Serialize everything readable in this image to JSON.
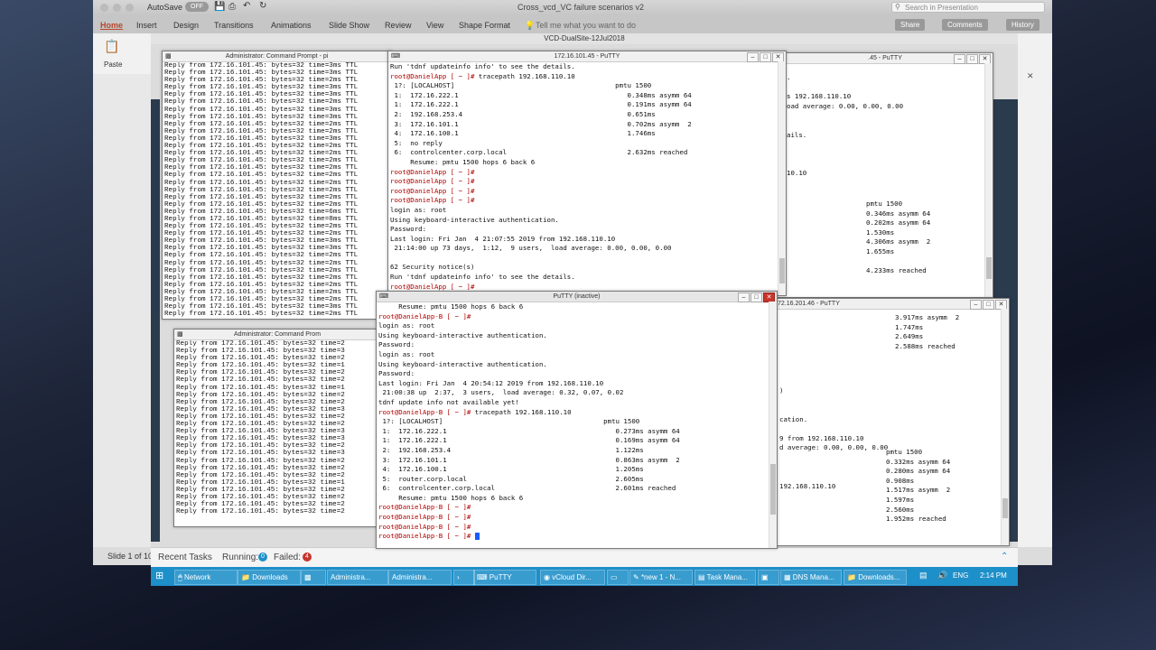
{
  "app": {
    "title": "Cross_vcd_VC failure scenarios v2",
    "autosave": "AutoSave",
    "autosave_state": "OFF",
    "search_placeholder": "Search in Presentation",
    "share": "Share",
    "comments": "Comments",
    "history": "History"
  },
  "menu": [
    "Home",
    "Insert",
    "Design",
    "Transitions",
    "Animations",
    "Slide Show",
    "Review",
    "View",
    "Shape Format"
  ],
  "tell_me": "Tell me what you want to do",
  "ribbon": {
    "paste": "Paste"
  },
  "status": {
    "slide": "Slide 1 of 10"
  },
  "rdp": {
    "title": "VCD-DualSite-12Jul2018"
  },
  "recent_tasks": {
    "label": "Recent Tasks",
    "running_label": "Running:",
    "running": "0",
    "failed_label": "Failed:",
    "failed": "4"
  },
  "taskbar": {
    "items": [
      "Network",
      "Downloads",
      "",
      "Administra...",
      "Administra...",
      "",
      "PuTTY",
      "vCloud Dir...",
      "",
      "*new 1 - N...",
      "Task Mana...",
      "",
      "DNS Mana...",
      "Downloads..."
    ],
    "lang": "ENG",
    "time": "2:14 PM"
  },
  "windows": {
    "cmd1": {
      "title": "Administrator: Command Prompt - pi"
    },
    "cmd2": {
      "title": "Administrator: Command Prom"
    },
    "putty_top": {
      "title": "172.16.101.45 - PuTTY"
    },
    "putty_right_top": {
      "title": ".45 - PuTTY"
    },
    "putty_inactive": {
      "title": "PuTTY (inactive)"
    },
    "putty_right_bottom": {
      "title": "72.16.201.46 - PuTTY"
    }
  },
  "cmd1_lines": [
    "Reply from 172.16.101.45: bytes=32 time=3ms TTL",
    "Reply from 172.16.101.45: bytes=32 time=3ms TTL",
    "Reply from 172.16.101.45: bytes=32 time=2ms TTL",
    "Reply from 172.16.101.45: bytes=32 time=3ms TTL",
    "Reply from 172.16.101.45: bytes=32 time=3ms TTL",
    "Reply from 172.16.101.45: bytes=32 time=2ms TTL",
    "Reply from 172.16.101.45: bytes=32 time=3ms TTL",
    "Reply from 172.16.101.45: bytes=32 time=3ms TTL",
    "Reply from 172.16.101.45: bytes=32 time=2ms TTL",
    "Reply from 172.16.101.45: bytes=32 time=2ms TTL",
    "Reply from 172.16.101.45: bytes=32 time=3ms TTL",
    "Reply from 172.16.101.45: bytes=32 time=2ms TTL",
    "Reply from 172.16.101.45: bytes=32 time=2ms TTL",
    "Reply from 172.16.101.45: bytes=32 time=2ms TTL",
    "Reply from 172.16.101.45: bytes=32 time=2ms TTL",
    "Reply from 172.16.101.45: bytes=32 time=2ms TTL",
    "Reply from 172.16.101.45: bytes=32 time=2ms TTL",
    "Reply from 172.16.101.45: bytes=32 time=2ms TTL",
    "Reply from 172.16.101.45: bytes=32 time=2ms TTL",
    "Reply from 172.16.101.45: bytes=32 time=2ms TTL",
    "Reply from 172.16.101.45: bytes=32 time=6ms TTL",
    "Reply from 172.16.101.45: bytes=32 time=8ms TTL",
    "Reply from 172.16.101.45: bytes=32 time=2ms TTL",
    "Reply from 172.16.101.45: bytes=32 time=2ms TTL",
    "Reply from 172.16.101.45: bytes=32 time=3ms TTL",
    "Reply from 172.16.101.45: bytes=32 time=3ms TTL",
    "Reply from 172.16.101.45: bytes=32 time=2ms TTL",
    "Reply from 172.16.101.45: bytes=32 time=2ms TTL",
    "Reply from 172.16.101.45: bytes=32 time=2ms TTL",
    "Reply from 172.16.101.45: bytes=32 time=2ms TTL",
    "Reply from 172.16.101.45: bytes=32 time=2ms TTL",
    "Reply from 172.16.101.45: bytes=32 time=2ms TTL",
    "Reply from 172.16.101.45: bytes=32 time=2ms TTL",
    "Reply from 172.16.101.45: bytes=32 time=3ms TTL",
    "Reply from 172.16.101.45: bytes=32 time=2ms TTL"
  ],
  "cmd2_lines": [
    "Reply from 172.16.101.45: bytes=32 time=2",
    "Reply from 172.16.101.45: bytes=32 time=3",
    "Reply from 172.16.101.45: bytes=32 time=2",
    "Reply from 172.16.101.45: bytes=32 time=1",
    "Reply from 172.16.101.45: bytes=32 time=2",
    "Reply from 172.16.101.45: bytes=32 time=2",
    "Reply from 172.16.101.45: bytes=32 time=1",
    "Reply from 172.16.101.45: bytes=32 time=2",
    "Reply from 172.16.101.45: bytes=32 time=2",
    "Reply from 172.16.101.45: bytes=32 time=3",
    "Reply from 172.16.101.45: bytes=32 time=2",
    "Reply from 172.16.101.45: bytes=32 time=2",
    "Reply from 172.16.101.45: bytes=32 time=3",
    "Reply from 172.16.101.45: bytes=32 time=3",
    "Reply from 172.16.101.45: bytes=32 time=2",
    "Reply from 172.16.101.45: bytes=32 time=3",
    "Reply from 172.16.101.45: bytes=32 time=2",
    "Reply from 172.16.101.45: bytes=32 time=2",
    "Reply from 172.16.101.45: bytes=32 time=2",
    "Reply from 172.16.101.45: bytes=32 time=1",
    "Reply from 172.16.101.45: bytes=32 time=2",
    "Reply from 172.16.101.45: bytes=32 time=2",
    "Reply from 172.16.101.45: bytes=32 time=2",
    "Reply from 172.16.101.45: bytes=32 time=2"
  ],
  "putty_top_lines": [
    {
      "t": "Run 'tdnf updateinfo info' to see the details."
    },
    {
      "p": "root@DanielApp [ ~ ]#",
      "t": " tracepath 192.168.110.10"
    },
    {
      "t": " 1?: [LOCALHOST]                                        pmtu 1500"
    },
    {
      "t": " 1:  172.16.222.1                                          0.348ms asymm 64"
    },
    {
      "t": " 1:  172.16.222.1                                          0.191ms asymm 64"
    },
    {
      "t": " 2:  192.168.253.4                                         0.651ms"
    },
    {
      "t": " 3:  172.16.101.1                                          0.702ms asymm  2"
    },
    {
      "t": " 4:  172.16.100.1                                          1.746ms"
    },
    {
      "t": " 5:  no reply"
    },
    {
      "t": " 6:  controlcenter.corp.local                              2.632ms reached"
    },
    {
      "t": "     Resume: pmtu 1500 hops 6 back 6"
    },
    {
      "p": "root@DanielApp [ ~ ]#",
      "t": ""
    },
    {
      "p": "root@DanielApp [ ~ ]#",
      "t": ""
    },
    {
      "p": "root@DanielApp [ ~ ]#",
      "t": ""
    },
    {
      "p": "root@DanielApp [ ~ ]#",
      "t": ""
    },
    {
      "t": "login as: root"
    },
    {
      "t": "Using keyboard-interactive authentication."
    },
    {
      "t": "Password:"
    },
    {
      "t": "Last login: Fri Jan  4 21:07:55 2019 from 192.168.110.10"
    },
    {
      "t": " 21:14:00 up 73 days,  1:12,  9 users,  load average: 0.00, 0.00, 0.00"
    },
    {
      "t": ""
    },
    {
      "t": "62 Security notice(s)"
    },
    {
      "t": "Run 'tdnf updateinfo info' to see the details."
    },
    {
      "p": "root@DanielApp [ ~ ]#",
      "t": ""
    }
  ],
  "putty_right_top_lines": [
    ".",
    "",
    "s 192.168.110.10",
    "oad average: 0.00, 0.00, 0.00",
    "",
    "",
    "ails.",
    "",
    "",
    "",
    "10.10",
    "",
    "",
    "",
    "",
    "",
    "",
    ""
  ],
  "putty_right_top_hops": [
    {
      "t": "pmtu 1500"
    },
    {
      "t": "0.346ms asymm 64"
    },
    {
      "t": "0.202ms asymm 64"
    },
    {
      "t": "1.530ms"
    },
    {
      "t": "4.306ms asymm  2"
    },
    {
      "t": "1.655ms"
    },
    {
      "t": ""
    },
    {
      "t": "4.233ms reached"
    }
  ],
  "putty_inactive_lines": [
    {
      "t": "     Resume: pmtu 1500 hops 6 back 6"
    },
    {
      "p": "root@DanielApp-B [ ~ ]#",
      "t": ""
    },
    {
      "t": "login as: root"
    },
    {
      "t": "Using keyboard-interactive authentication."
    },
    {
      "t": "Password:"
    },
    {
      "t": "login as: root"
    },
    {
      "t": "Using keyboard-interactive authentication."
    },
    {
      "t": "Password:"
    },
    {
      "t": "Last login: Fri Jan  4 20:54:12 2019 from 192.168.110.10"
    },
    {
      "t": " 21:00:38 up  2:37,  3 users,  load average: 0.32, 0.07, 0.02"
    },
    {
      "t": "tdnf update info not available yet!"
    },
    {
      "p": "root@DanielApp-B [ ~ ]#",
      "t": " tracepath 192.168.110.10"
    },
    {
      "t": " 1?: [LOCALHOST]                                        pmtu 1500"
    },
    {
      "t": " 1:  172.16.222.1                                          0.273ms asymm 64"
    },
    {
      "t": " 1:  172.16.222.1                                          0.169ms asymm 64"
    },
    {
      "t": " 2:  192.168.253.4                                         1.122ms"
    },
    {
      "t": " 3:  172.16.101.1                                          0.863ms asymm  2"
    },
    {
      "t": " 4:  172.16.100.1                                          1.205ms"
    },
    {
      "t": " 5:  router.corp.local                                     2.605ms"
    },
    {
      "t": " 6:  controlcenter.corp.local                              2.601ms reached"
    },
    {
      "t": "     Resume: pmtu 1500 hops 6 back 6"
    },
    {
      "p": "root@DanielApp-B [ ~ ]#",
      "t": ""
    },
    {
      "p": "root@DanielApp-B [ ~ ]#",
      "t": ""
    },
    {
      "p": "root@DanielApp-B [ ~ ]#",
      "t": ""
    },
    {
      "p": "root@DanielApp-B [ ~ ]#",
      "t": "",
      "cursor": true
    }
  ],
  "putty_right_bottom_left": [
    "",
    "",
    "",
    "",
    "",
    "",
    "",
    "",
    ")",
    "",
    "",
    "cation.",
    "",
    "9 from 192.168.110.10",
    "d average: 0.00, 0.00, 0.00",
    "",
    "",
    "",
    "192.168.110.10",
    "",
    "",
    "",
    "",
    "",
    "",
    "",
    "",
    ""
  ],
  "putty_right_bottom_hops": [
    {
      "t": "3.917ms asymm  2"
    },
    {
      "t": "1.747ms"
    },
    {
      "t": "2.649ms"
    },
    {
      "t": "2.588ms reached"
    }
  ],
  "putty_right_bottom_hops2": [
    {
      "t": "pmtu 1500"
    },
    {
      "t": "0.332ms asymm 64"
    },
    {
      "t": "0.280ms asymm 64"
    },
    {
      "t": "0.908ms"
    },
    {
      "t": "1.517ms asymm  2"
    },
    {
      "t": "1.597ms"
    },
    {
      "t": "2.560ms"
    },
    {
      "t": "1.952ms reached"
    }
  ]
}
